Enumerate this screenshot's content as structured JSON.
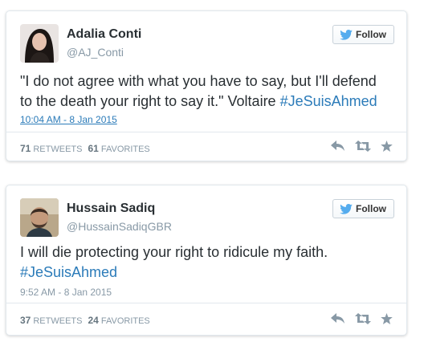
{
  "tweets": [
    {
      "name": "Adalia Conti",
      "handle": "@AJ_Conti",
      "follow_label": "Follow",
      "text": "\"I do not agree with what you have to say, but I'll defend to the death your right to say it.\" Voltaire ",
      "hashtag": "#JeSuisAhmed",
      "timestamp": "10:04 AM - 8 Jan 2015",
      "retweets": "71",
      "retweets_label": "RETWEETS",
      "favorites": "61",
      "favorites_label": "FAVORITES"
    },
    {
      "name": "Hussain Sadiq",
      "handle": "@HussainSadiqGBR",
      "follow_label": "Follow",
      "text": "I will die protecting your right to ridicule my faith. ",
      "hashtag": "#JeSuisAhmed",
      "timestamp": "9:52 AM - 8 Jan 2015",
      "retweets": "37",
      "retweets_label": "RETWEETS",
      "favorites": "24",
      "favorites_label": "FAVORITES"
    }
  ],
  "colors": {
    "link": "#2b7bb9",
    "muted": "#8899a6",
    "text": "#292f33",
    "twitter_blue": "#55acee"
  },
  "icons": {
    "follow": "twitter-bird-icon",
    "reply": "reply-icon",
    "retweet": "retweet-icon",
    "favorite": "star-icon"
  }
}
